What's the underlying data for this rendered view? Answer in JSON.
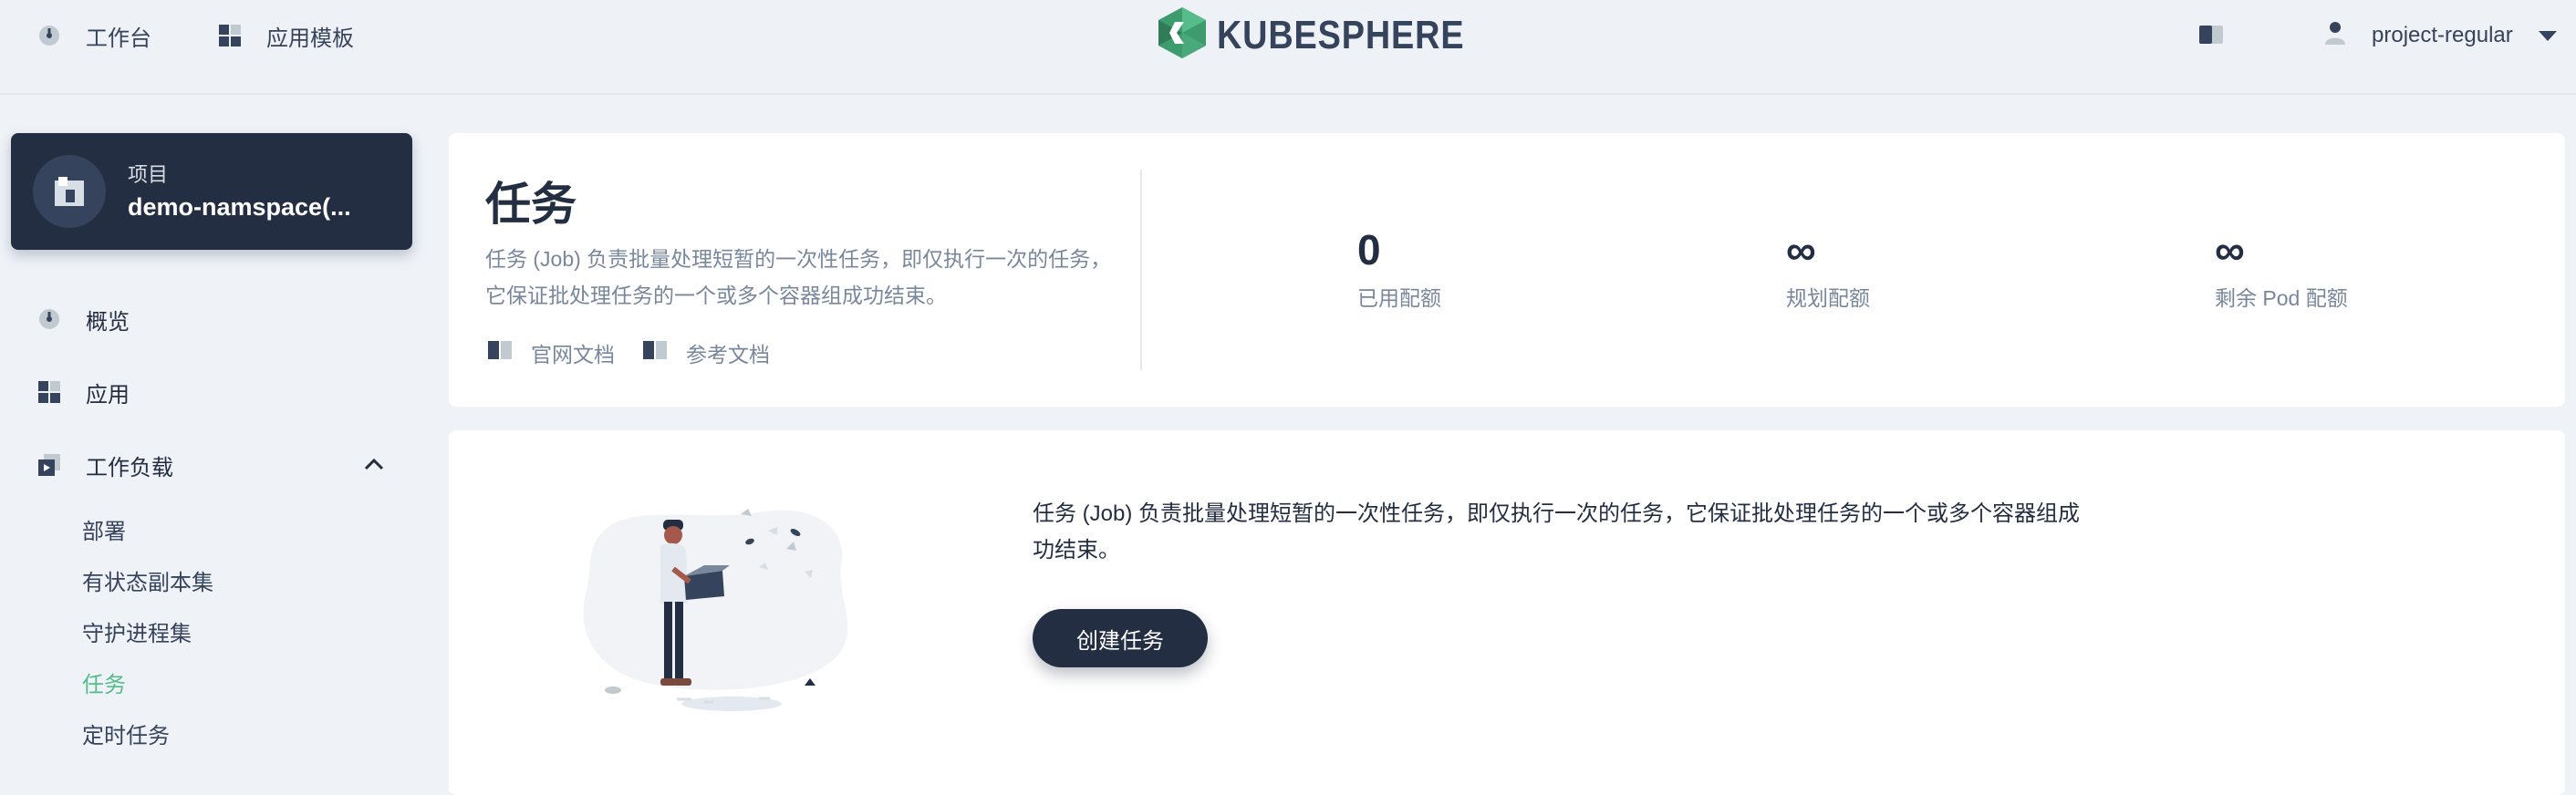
{
  "topbar": {
    "workbench": "工作台",
    "app_templates": "应用模板",
    "logo_text": "KUBESPHERE",
    "username": "project-regular"
  },
  "sidebar": {
    "project_type": "项目",
    "project_name": "demo-namspace(...",
    "menu": {
      "overview": "概览",
      "apps": "应用",
      "workloads": "工作负载"
    },
    "workload_items": [
      "部署",
      "有状态副本集",
      "守护进程集",
      "任务",
      "定时任务"
    ],
    "active_item": "任务"
  },
  "header": {
    "title": "任务",
    "description": "任务 (Job) 负责批量处理短暂的一次性任务，即仅执行一次的任务，它保证批处理任务的一个或多个容器组成功结束。",
    "links": [
      "官网文档",
      "参考文档"
    ],
    "quotas": [
      {
        "value": "0",
        "label": "已用配额"
      },
      {
        "value": "∞",
        "label": "规划配额"
      },
      {
        "value": "∞",
        "label": "剩余 Pod 配额"
      }
    ]
  },
  "empty": {
    "description": "任务 (Job) 负责批量处理短暂的一次性任务，即仅执行一次的任务，它保证批处理任务的一个或多个容器组成功结束。",
    "create_button": "创建任务"
  },
  "colors": {
    "primary_dark": "#242e42",
    "accent_green": "#55bc8a",
    "muted_text": "#79879c",
    "background": "#eff3f8"
  },
  "icons": [
    "dashboard-icon",
    "app-template-icon",
    "kubesphere-logo-icon",
    "sidebar-toggle-icon",
    "user-icon",
    "caret-down-icon",
    "project-icon",
    "overview-icon",
    "apps-icon",
    "workload-icon",
    "chevron-up-icon",
    "document-icon"
  ]
}
